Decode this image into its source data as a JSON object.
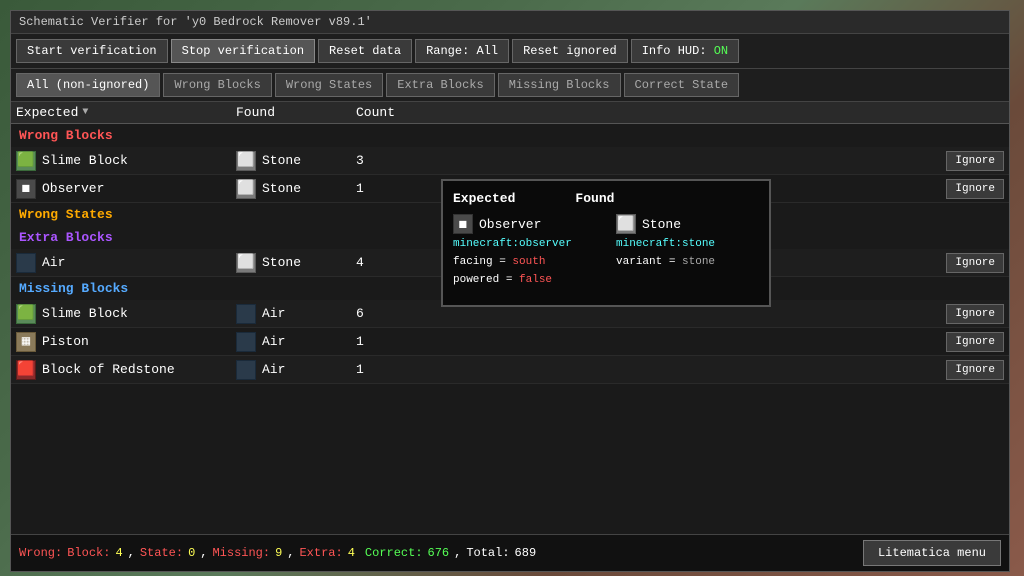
{
  "title": "Schematic Verifier for 'y0 Bedrock Remover v89.1'",
  "toolbar": {
    "buttons": [
      {
        "label": "Start verification",
        "id": "start-verification"
      },
      {
        "label": "Stop verification",
        "id": "stop-verification"
      },
      {
        "label": "Reset data",
        "id": "reset-data"
      },
      {
        "label": "Range: All",
        "id": "range-all"
      },
      {
        "label": "Reset ignored",
        "id": "reset-ignored"
      },
      {
        "label": "Info HUD: ",
        "id": "info-hud",
        "status": "ON"
      }
    ]
  },
  "filter_tabs": [
    {
      "label": "All (non-ignored)",
      "id": "all",
      "active": true
    },
    {
      "label": "Wrong Blocks",
      "id": "wrong-blocks"
    },
    {
      "label": "Wrong States",
      "id": "wrong-states"
    },
    {
      "label": "Extra Blocks",
      "id": "extra-blocks"
    },
    {
      "label": "Missing Blocks",
      "id": "missing-blocks"
    },
    {
      "label": "Correct State",
      "id": "correct-state"
    }
  ],
  "table": {
    "headers": {
      "expected": "Expected",
      "found": "Found",
      "count": "Count"
    }
  },
  "sections": {
    "wrong_blocks": {
      "label": "Wrong Blocks",
      "rows": [
        {
          "expected_icon": "slime",
          "expected": "Slime Block",
          "found_icon": "stone",
          "found": "Stone",
          "count": "3"
        },
        {
          "expected_icon": "observer",
          "expected": "Observer",
          "found_icon": "stone",
          "found": "Stone",
          "count": "1"
        }
      ]
    },
    "wrong_states": {
      "label": "Wrong States",
      "rows": []
    },
    "extra_blocks": {
      "label": "Extra Blocks",
      "rows": [
        {
          "expected_icon": "air",
          "expected": "Air",
          "found_icon": "stone",
          "found": "Stone",
          "count": "4"
        }
      ]
    },
    "missing_blocks": {
      "label": "Missing Blocks",
      "rows": [
        {
          "expected_icon": "slime",
          "expected": "Slime Block",
          "found_icon": "air",
          "found": "Air",
          "count": "6"
        },
        {
          "expected_icon": "piston",
          "expected": "Piston",
          "found_icon": "air",
          "found": "Air",
          "count": "1"
        },
        {
          "expected_icon": "redstone",
          "expected": "Block of Redstone",
          "found_icon": "air",
          "found": "Air",
          "count": "1"
        }
      ]
    }
  },
  "tooltip": {
    "header_expected": "Expected",
    "header_found": "Found",
    "expected_block": "Observer",
    "expected_id": "minecraft:observer",
    "expected_prop1_key": "facing",
    "expected_prop1_eq": "=",
    "expected_prop1_val": "south",
    "expected_prop2_key": "powered",
    "expected_prop2_eq": "=",
    "expected_prop2_val": "false",
    "found_block": "Stone",
    "found_id": "minecraft:stone",
    "found_prop_key": "variant",
    "found_prop_eq": "=",
    "found_prop_val": "stone"
  },
  "status": {
    "wrong_label": "Wrong:",
    "block_label": "Block:",
    "block_val": "4",
    "state_label": "State:",
    "state_val": "0",
    "missing_label": "Missing:",
    "missing_val": "9",
    "extra_label": "Extra:",
    "extra_val": "4",
    "correct_label": "Correct:",
    "correct_val": "676",
    "total_label": "Total:",
    "total_val": "689"
  },
  "litematica_btn": "Litematica menu",
  "ignore_label": "Ignore"
}
